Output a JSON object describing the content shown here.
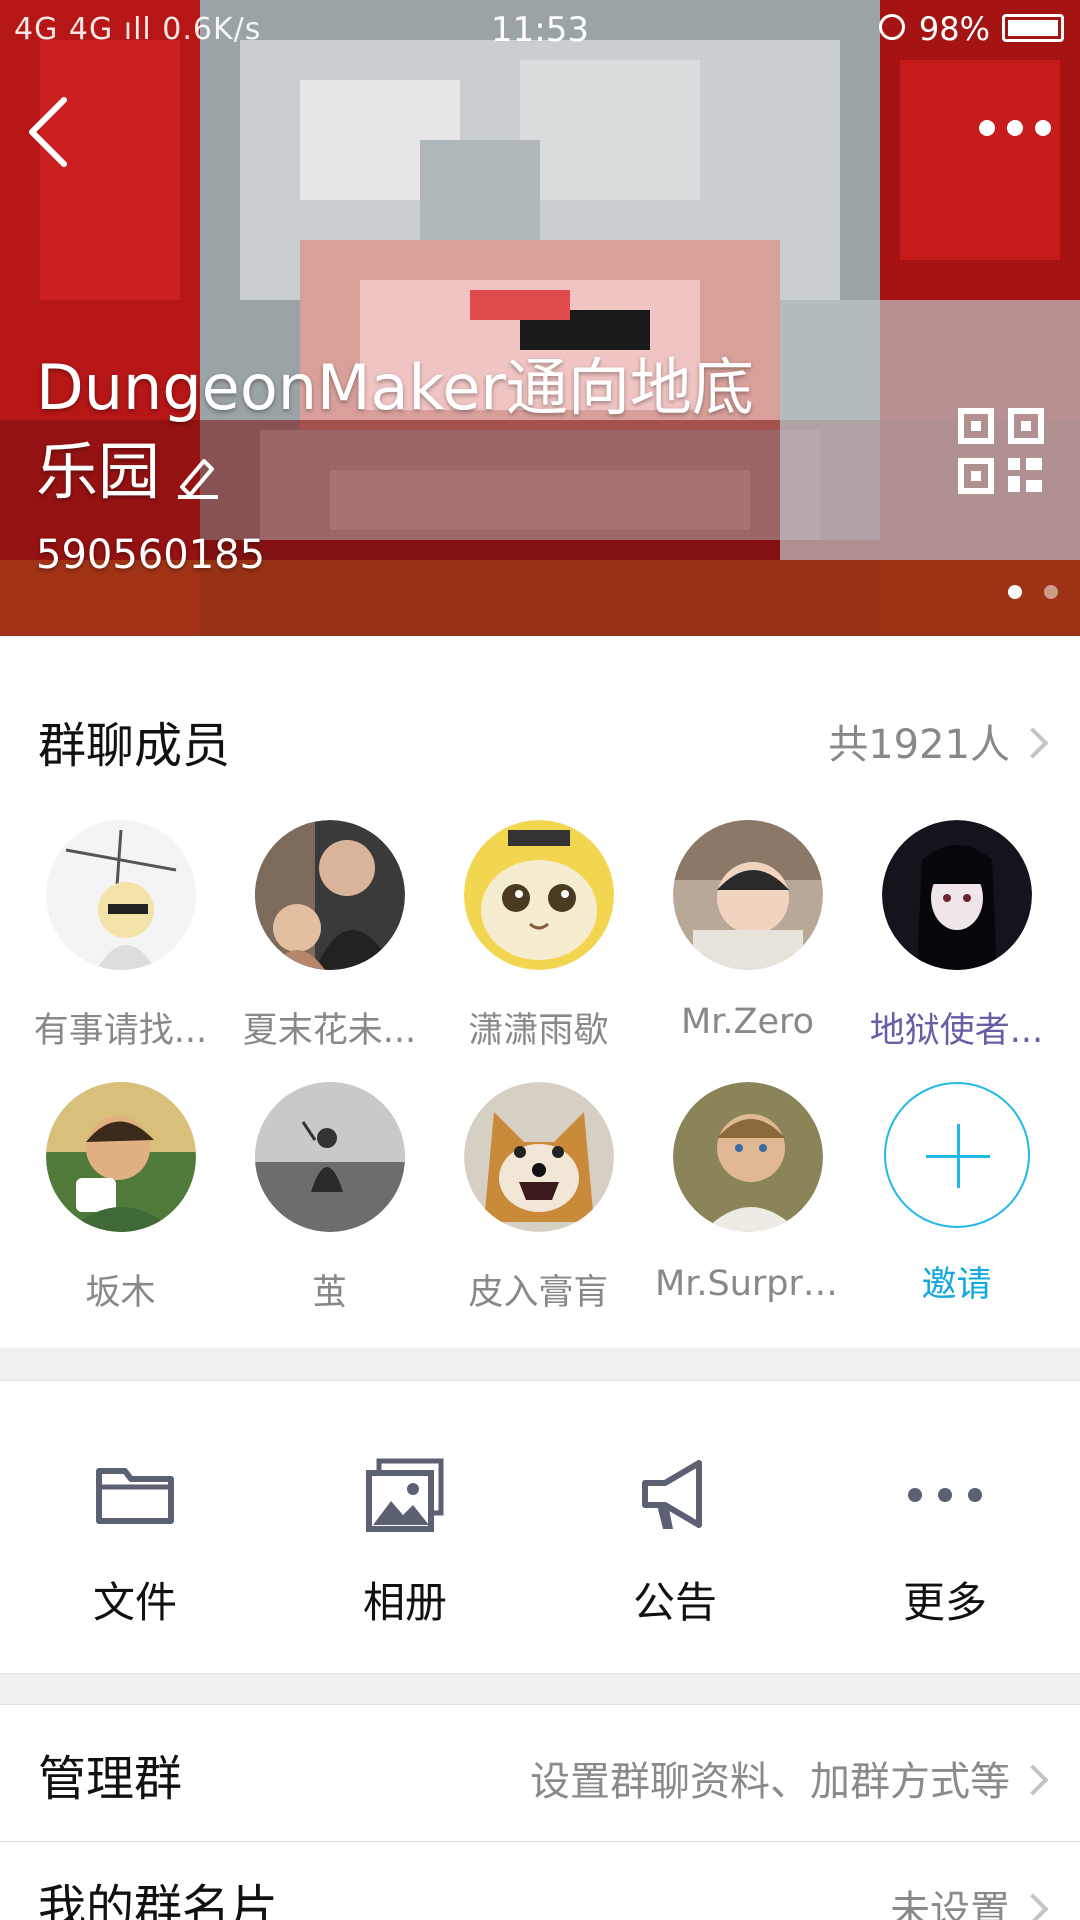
{
  "status_bar": {
    "left": "4G 4G ıll 0.6K/s",
    "time": "11:53",
    "battery": "98%"
  },
  "header": {
    "group_name_line1": "DungeonMaker通向地底",
    "group_name_line2": "乐园",
    "group_id": "590560185",
    "icons": [
      "back-icon",
      "more-icon",
      "edit-icon",
      "qr-code-icon"
    ],
    "pager_count": 2,
    "pager_active": 0
  },
  "members": {
    "title": "群聊成员",
    "count_text": "共1921人",
    "items": [
      {
        "name": "有事请找..."
      },
      {
        "name": "夏末花未..."
      },
      {
        "name": "潇潇雨歇"
      },
      {
        "name": "Mr.Zero"
      },
      {
        "name": "地狱使者..."
      },
      {
        "name": "坂木"
      },
      {
        "name": "茧"
      },
      {
        "name": "皮入膏肓"
      },
      {
        "name": "Mr.Surpri..."
      }
    ],
    "invite_label": "邀请",
    "colors": {
      "highlight_name": "#6b5ca5",
      "invite": "#12a8e0"
    }
  },
  "tools": {
    "files": "文件",
    "album": "相册",
    "notice": "公告",
    "more": "更多"
  },
  "manage": {
    "label": "管理群",
    "value": "设置群聊资料、加群方式等"
  },
  "my_card": {
    "label": "我的群名片",
    "value": "未设置"
  }
}
